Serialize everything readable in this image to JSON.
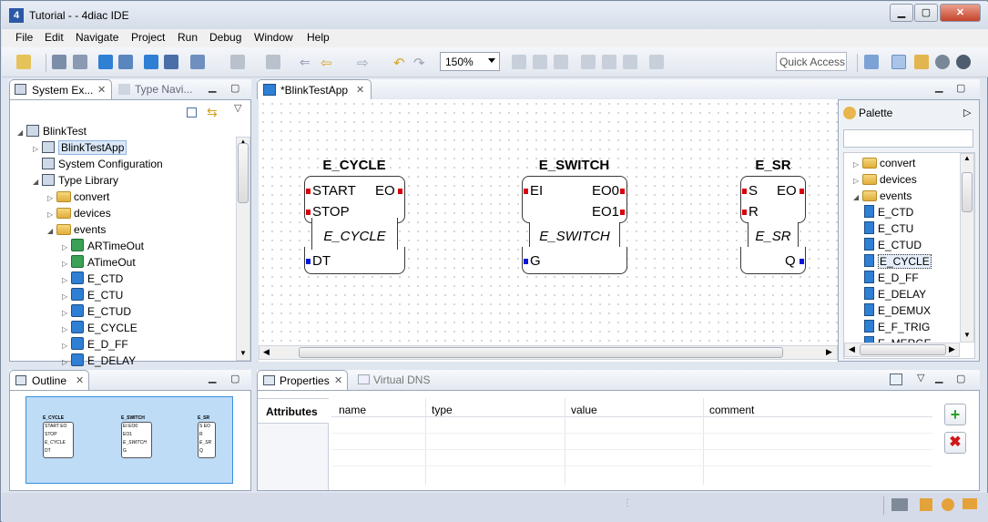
{
  "window": {
    "title": "Tutorial -  - 4diac IDE",
    "app_icon": "4"
  },
  "menu": [
    "File",
    "Edit",
    "Navigate",
    "Project",
    "Run",
    "Debug",
    "Window",
    "Help"
  ],
  "toolbar": {
    "zoom": "150%",
    "quick_access": "Quick Access"
  },
  "left_tabs": {
    "system_explorer": "System Ex...",
    "type_navigator": "Type Navi..."
  },
  "tree": [
    {
      "label": "BlinkTest",
      "icon": "system-icon"
    },
    {
      "label": "BlinkTestApp",
      "icon": "app-icon",
      "selected": true
    },
    {
      "label": "System Configuration",
      "icon": "sysconf-icon"
    },
    {
      "label": "Type Library",
      "icon": "library-icon"
    },
    {
      "label": "convert",
      "icon": "folder-icon"
    },
    {
      "label": "devices",
      "icon": "folder-icon"
    },
    {
      "label": "events",
      "icon": "folder-icon"
    },
    {
      "label": "ARTimeOut",
      "icon": "fb-icon"
    },
    {
      "label": "ATimeOut",
      "icon": "fb-icon"
    },
    {
      "label": "E_CTD",
      "icon": "fb-icon"
    },
    {
      "label": "E_CTU",
      "icon": "fb-icon"
    },
    {
      "label": "E_CTUD",
      "icon": "fb-icon"
    },
    {
      "label": "E_CYCLE",
      "icon": "fb-icon"
    },
    {
      "label": "E_D_FF",
      "icon": "fb-icon"
    },
    {
      "label": "E_DELAY",
      "icon": "fb-icon"
    }
  ],
  "editor_tab": "*BlinkTestApp",
  "function_blocks": [
    {
      "name": "E_CYCLE",
      "type": "E_CYCLE",
      "inputs": [
        "START",
        "STOP"
      ],
      "outputs": [
        "EO"
      ],
      "data_in": [
        "DT"
      ],
      "data_out": []
    },
    {
      "name": "E_SWITCH",
      "type": "E_SWITCH",
      "inputs": [
        "EI"
      ],
      "outputs": [
        "EO0",
        "EO1"
      ],
      "data_in": [
        "G"
      ],
      "data_out": []
    },
    {
      "name": "E_SR",
      "type": "E_SR",
      "inputs": [
        "S",
        "R"
      ],
      "outputs": [
        "EO"
      ],
      "data_in": [],
      "data_out": [
        "Q"
      ]
    }
  ],
  "palette": {
    "title": "Palette",
    "items": [
      {
        "label": "convert",
        "kind": "folder"
      },
      {
        "label": "devices",
        "kind": "folder"
      },
      {
        "label": "events",
        "kind": "folder"
      },
      {
        "label": "E_CTD",
        "kind": "fb"
      },
      {
        "label": "E_CTU",
        "kind": "fb"
      },
      {
        "label": "E_CTUD",
        "kind": "fb"
      },
      {
        "label": "E_CYCLE",
        "kind": "fb",
        "selected": true
      },
      {
        "label": "E_D_FF",
        "kind": "fb"
      },
      {
        "label": "E_DELAY",
        "kind": "fb"
      },
      {
        "label": "E_DEMUX",
        "kind": "fb"
      },
      {
        "label": "E_F_TRIG",
        "kind": "fb"
      },
      {
        "label": "E_MERGE",
        "kind": "fb"
      }
    ]
  },
  "outline_tab": "Outline",
  "properties": {
    "tab": "Properties",
    "tab2": "Virtual DNS",
    "section": "Attributes",
    "columns": [
      "name",
      "type",
      "value",
      "comment"
    ]
  },
  "outline_blocks": [
    {
      "name": "E_CYCLE",
      "ports": [
        "START EO",
        "STOP",
        "E_CYCLE",
        "DT"
      ]
    },
    {
      "name": "E_SWITCH",
      "ports": [
        "EI  EO0",
        "EO1",
        "E_SWITCH",
        "G"
      ]
    },
    {
      "name": "E_SR",
      "ports": [
        "S EO",
        "R",
        "E_SR",
        "Q"
      ]
    }
  ]
}
